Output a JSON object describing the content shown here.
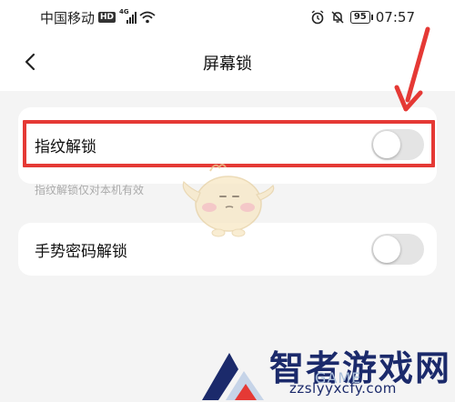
{
  "status_bar": {
    "carrier": "中国移动",
    "hd_badge": "HD",
    "network": "4G",
    "battery": "95",
    "time": "07:57"
  },
  "header": {
    "title": "屏幕锁"
  },
  "settings": {
    "fingerprint": {
      "label": "指纹解锁",
      "enabled": false,
      "hint": "指纹解锁仅对本机有效"
    },
    "gesture": {
      "label": "手势密码解锁",
      "enabled": false
    }
  },
  "watermark": {
    "brand": "智者游戏网",
    "game_text": "GAME",
    "url": "zzslyyxcfy.com"
  },
  "colors": {
    "highlight": "#e53935",
    "toggle_off": "#e4e4e4",
    "watermark": "#1b2a6b"
  },
  "icons": [
    "back-icon",
    "signal-icon",
    "wifi-icon",
    "alarm-icon",
    "mute-icon",
    "battery-icon"
  ]
}
